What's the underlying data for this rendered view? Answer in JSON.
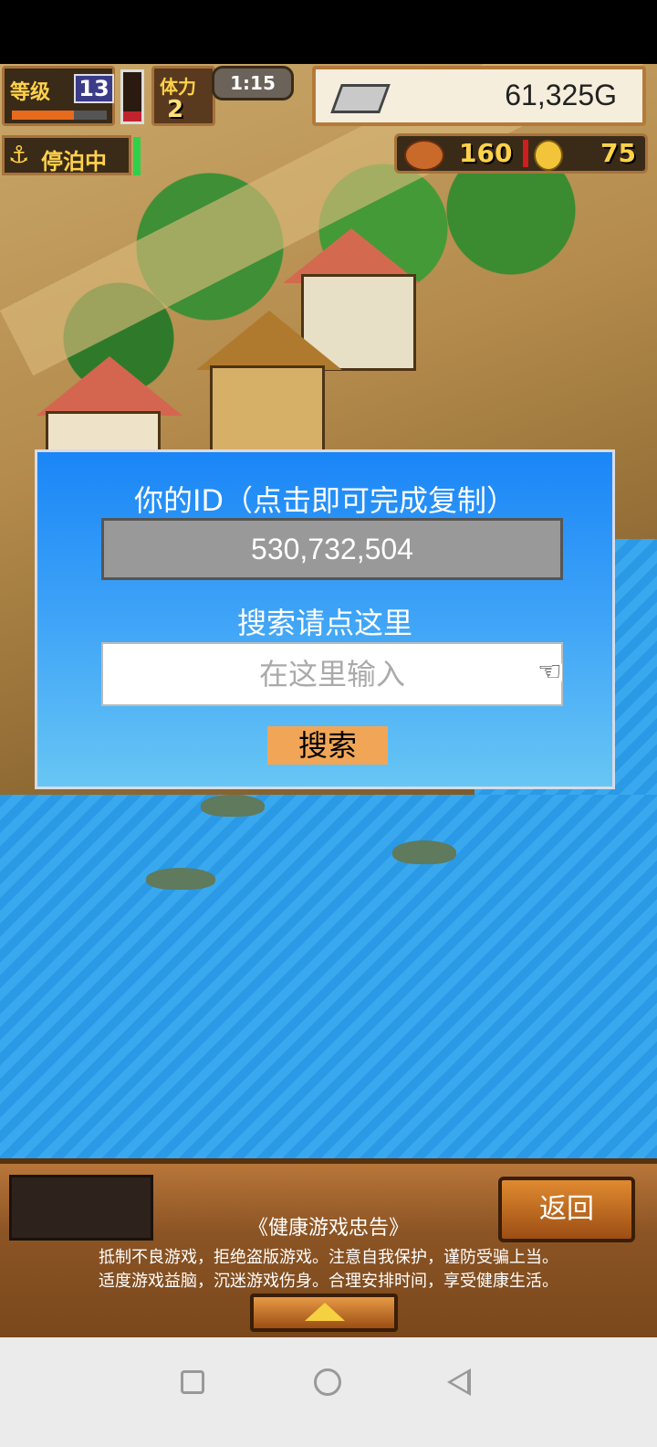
{
  "hud": {
    "level_label": "等级",
    "level_value": "13",
    "level_progress": 0.65,
    "stamina_label": "体力",
    "stamina_value": "2",
    "timer": "1:15",
    "gold": "61,325G",
    "docked_label": "停泊中",
    "food": "160",
    "medals": "75"
  },
  "dialog": {
    "title": "你的ID（点击即可完成复制）",
    "id_value": "530,732,504",
    "search_title": "搜索请点这里",
    "search_placeholder": "在这里输入",
    "search_button": "搜索"
  },
  "bottom": {
    "back_button": "返回",
    "notice_title": "《健康游戏忠告》",
    "notice_line1": "抵制不良游戏，拒绝盗版游戏。注意自我保护，谨防受骗上当。",
    "notice_line2": "适度游戏益脑，沉迷游戏伤身。合理安排时间，享受健康生活。"
  },
  "icons": {
    "hand": "pointing-hand-icon",
    "anchor": "anchor-icon"
  }
}
